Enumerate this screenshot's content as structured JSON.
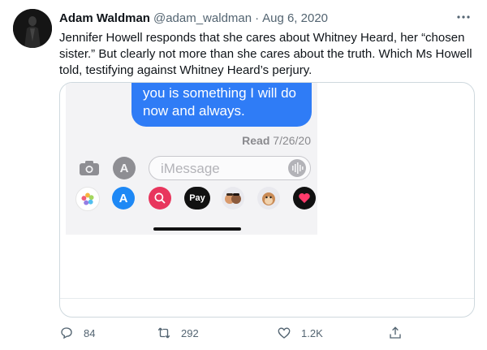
{
  "tweet": {
    "author_name": "Adam Waldman",
    "author_handle": "@adam_waldman",
    "separator": "·",
    "date": "Aug 6, 2020",
    "more_icon": "more-icon",
    "text": "Jennifer Howell responds that she cares about Whitney Heard, her “chosen sister.” But clearly not more than she cares about the truth. Which Ms Howell told, testifying against Whitney Heard’s perjury."
  },
  "media": {
    "bubble_text": "you is something I will do now and always.",
    "read_label": "Read",
    "read_date": "7/26/20",
    "composer_placeholder": "iMessage",
    "apps_icons": [
      "photos-icon",
      "app-store-icon",
      "search-images-icon",
      "apple-pay-icon",
      "memoji-icon",
      "animoji-icon",
      "digital-touch-icon"
    ],
    "apple_pay_label": "Pay"
  },
  "actions": {
    "reply_count": "84",
    "retweet_count": "292",
    "like_count": "1.2K"
  },
  "colors": {
    "bubble": "#2f7cf6",
    "secondary_text": "#536471"
  }
}
